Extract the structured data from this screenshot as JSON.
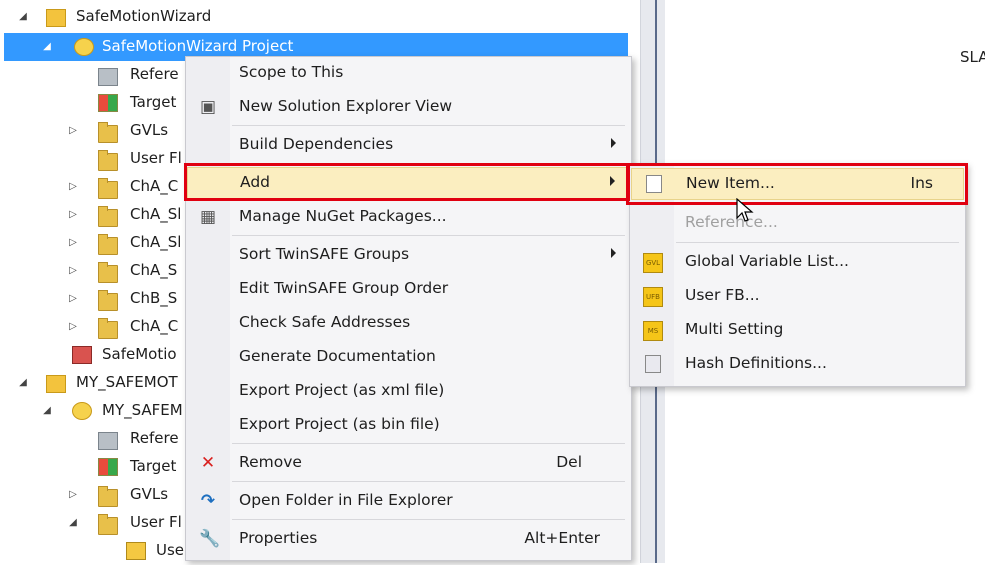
{
  "tree": {
    "rows": [
      {
        "label": "SafeMotionWizard",
        "expander": "◢",
        "icon": "solution-icon"
      },
      {
        "label": "SafeMotionWizard Project",
        "expander": "◢",
        "icon": "project-icon"
      },
      {
        "label": "Refere",
        "expander": "",
        "icon": "references-icon"
      },
      {
        "label": "Target",
        "expander": "",
        "icon": "target-icon"
      },
      {
        "label": "GVLs",
        "expander": "▷",
        "icon": "folder-icon"
      },
      {
        "label": "User Fl",
        "expander": "",
        "icon": "folder-icon"
      },
      {
        "label": "ChA_C",
        "expander": "▷",
        "icon": "folder-icon"
      },
      {
        "label": "ChA_Sl",
        "expander": "▷",
        "icon": "folder-icon"
      },
      {
        "label": "ChA_Sl",
        "expander": "▷",
        "icon": "folder-icon"
      },
      {
        "label": "ChA_S",
        "expander": "▷",
        "icon": "folder-icon"
      },
      {
        "label": "ChB_S",
        "expander": "▷",
        "icon": "folder-icon"
      },
      {
        "label": "ChA_C",
        "expander": "▷",
        "icon": "folder-icon"
      },
      {
        "label": "SafeMotio",
        "expander": "",
        "icon": "safemotion-icon"
      },
      {
        "label": "MY_SAFEMOT",
        "expander": "◢",
        "icon": "solution-icon"
      },
      {
        "label": "MY_SAFEM",
        "expander": "◢",
        "icon": "project-icon"
      },
      {
        "label": "Refere",
        "expander": "",
        "icon": "references-icon"
      },
      {
        "label": "Target",
        "expander": "",
        "icon": "target-icon"
      },
      {
        "label": "GVLs",
        "expander": "▷",
        "icon": "folder-icon"
      },
      {
        "label": "User Fl",
        "expander": "◢",
        "icon": "folder-icon"
      },
      {
        "label": "Use",
        "expander": "",
        "icon": "user-fb-icon"
      }
    ]
  },
  "right_pane": {
    "text": "SLA"
  },
  "context_menu": {
    "items": [
      {
        "label": "Scope to This",
        "shortcut": "",
        "icon": ""
      },
      {
        "label": "New Solution Explorer View",
        "shortcut": "",
        "icon": "▣"
      },
      {
        "label": "Build Dependencies",
        "shortcut": "",
        "icon": "",
        "submenu": true
      },
      {
        "label": "Add",
        "shortcut": "",
        "icon": "",
        "submenu": true,
        "highlighted": true
      },
      {
        "label": "Manage NuGet Packages...",
        "shortcut": "",
        "icon": "▦"
      },
      {
        "label": "Sort TwinSAFE Groups",
        "shortcut": "",
        "icon": "",
        "submenu": true
      },
      {
        "label": "Edit TwinSAFE Group Order",
        "shortcut": "",
        "icon": ""
      },
      {
        "label": "Check Safe Addresses",
        "shortcut": "",
        "icon": ""
      },
      {
        "label": "Generate Documentation",
        "shortcut": "",
        "icon": ""
      },
      {
        "label": "Export Project (as xml file)",
        "shortcut": "",
        "icon": ""
      },
      {
        "label": "Export Project (as bin file)",
        "shortcut": "",
        "icon": ""
      },
      {
        "label": "Remove",
        "shortcut": "Del",
        "icon": "✕"
      },
      {
        "label": "Open Folder in File Explorer",
        "shortcut": "",
        "icon": "↷"
      },
      {
        "label": "Properties",
        "shortcut": "Alt+Enter",
        "icon": "🔧"
      }
    ]
  },
  "add_submenu": {
    "items": [
      {
        "label": "New Item...",
        "shortcut": "Ins",
        "icon": "new-item-icon",
        "highlighted": true
      },
      {
        "label": "Reference...",
        "shortcut": "",
        "icon": "",
        "disabled": true
      },
      {
        "label": "Global Variable List...",
        "shortcut": "",
        "icon": "gvl-icon",
        "icon_text": "GVL"
      },
      {
        "label": "User FB...",
        "shortcut": "",
        "icon": "user-fb-icon",
        "icon_text": "UFB"
      },
      {
        "label": "Multi Setting",
        "shortcut": "",
        "icon": "multi-setting-icon",
        "icon_text": "MS"
      },
      {
        "label": "Hash Definitions...",
        "shortcut": "",
        "icon": "hash-definitions-icon"
      }
    ]
  },
  "colors": {
    "selection": "#3399ff",
    "highlight": "#fbeec0",
    "annotation": "#e00010"
  }
}
